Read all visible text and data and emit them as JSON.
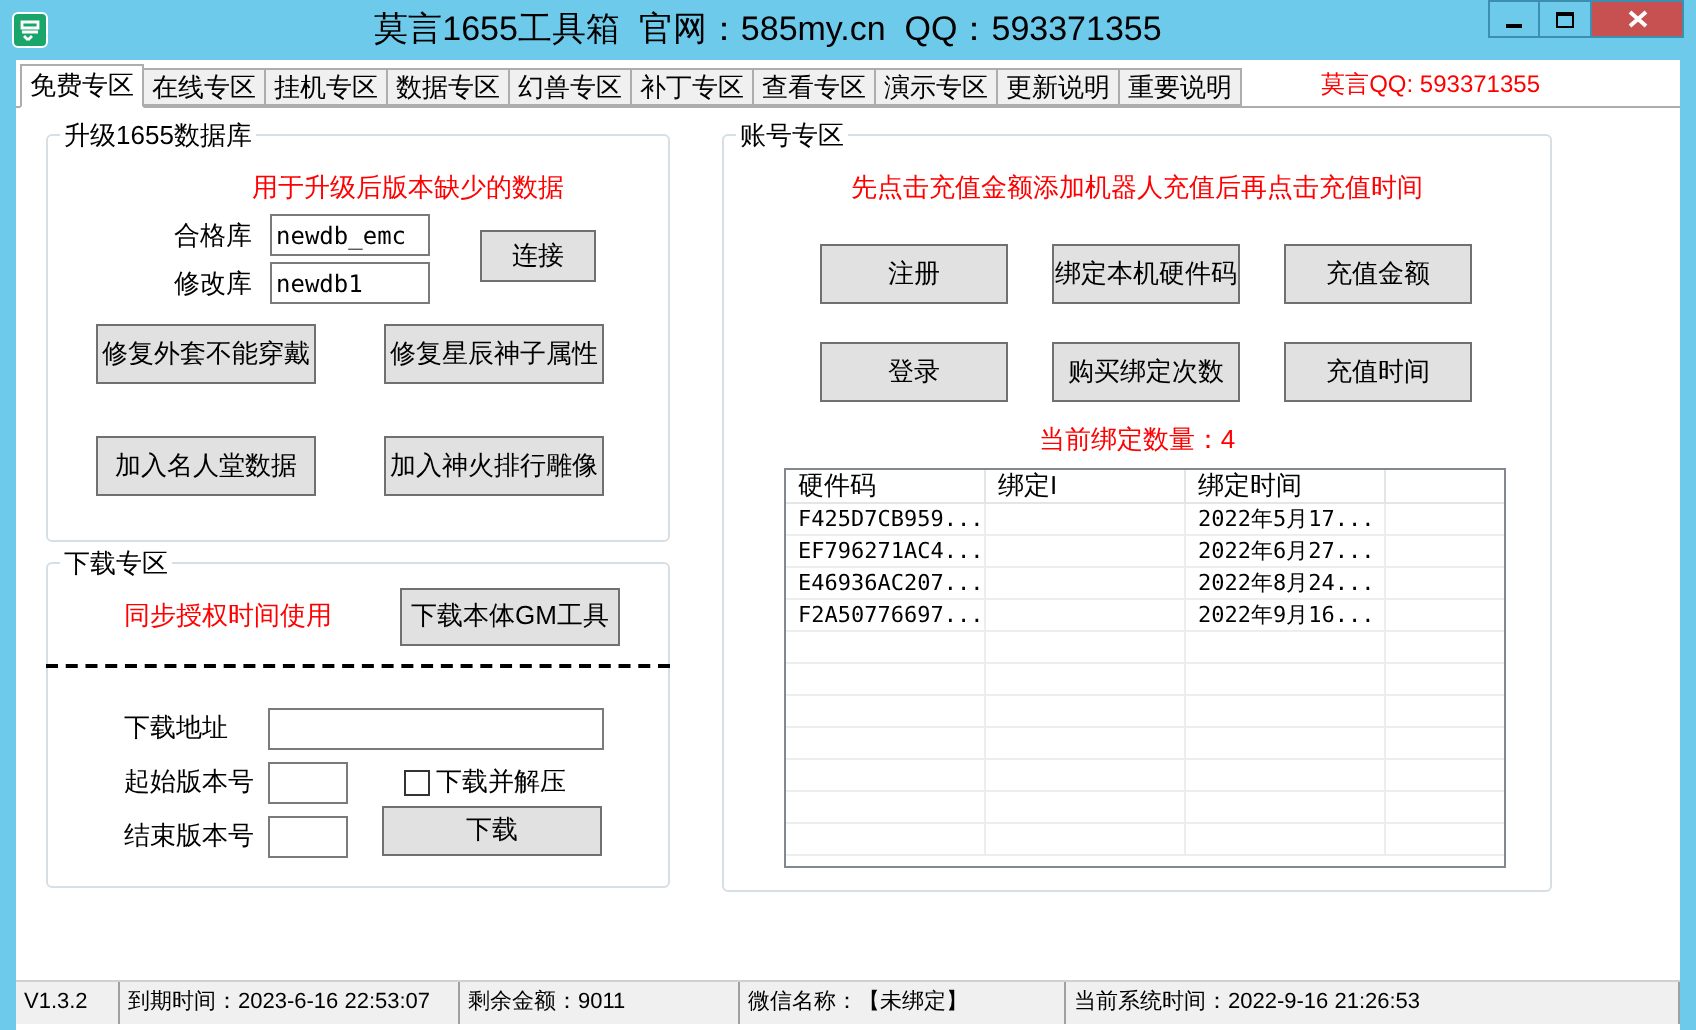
{
  "window": {
    "title": "莫言1655工具箱  官网：585my.cn  QQ：593371355"
  },
  "tabs": [
    {
      "label": "免费专区",
      "selected": true
    },
    {
      "label": "在线专区",
      "selected": false
    },
    {
      "label": "挂机专区",
      "selected": false
    },
    {
      "label": "数据专区",
      "selected": false
    },
    {
      "label": "幻兽专区",
      "selected": false
    },
    {
      "label": "补丁专区",
      "selected": false
    },
    {
      "label": "查看专区",
      "selected": false
    },
    {
      "label": "演示专区",
      "selected": false
    },
    {
      "label": "更新说明",
      "selected": false
    },
    {
      "label": "重要说明",
      "selected": false
    }
  ],
  "tab_note": "莫言QQ: 593371355",
  "upgrade": {
    "title": "升级1655数据库",
    "note": "用于升级后版本缺少的数据",
    "fields": [
      {
        "label": "合格库",
        "value": "newdb_emc"
      },
      {
        "label": "修改库",
        "value": "newdb1"
      }
    ],
    "connect_button": "连接",
    "buttons": [
      "修复外套不能穿戴",
      "修复星辰神子属性",
      "加入名人堂数据",
      "加入神火排行雕像"
    ]
  },
  "download": {
    "title": "下载专区",
    "note": "同步授权时间使用",
    "gm_button": "下载本体GM工具",
    "fields": [
      {
        "label": "下载地址"
      },
      {
        "label": "起始版本号"
      },
      {
        "label": "结束版本号"
      }
    ],
    "unzip": {
      "label": "下载并解压",
      "checked": false
    },
    "download_button": "下载"
  },
  "account": {
    "title": "账号专区",
    "note": "先点击充值金额添加机器人充值后再点击充值时间",
    "buttons": [
      "注册",
      "绑定本机硬件码",
      "充值金额",
      "登录",
      "购买绑定次数",
      "充值时间"
    ],
    "count": "当前绑定数量：4",
    "table": {
      "columns": [
        "硬件码",
        "绑定I",
        "绑定时间"
      ],
      "rows": [
        [
          "F425D7CB959...",
          "",
          "2022年5月17..."
        ],
        [
          "EF796271AC4...",
          "",
          "2022年6月27..."
        ],
        [
          "E46936AC207...",
          "",
          "2022年8月24..."
        ],
        [
          "F2A50776697...",
          "",
          "2022年9月16..."
        ]
      ]
    }
  },
  "status_bar": [
    "V1.3.2",
    "到期时间：2023-6-16 22:53:07",
    "剩余金额：9011",
    "微信名称：【未绑定】",
    "当前系统时间：2022-9-16 21:26:53"
  ]
}
